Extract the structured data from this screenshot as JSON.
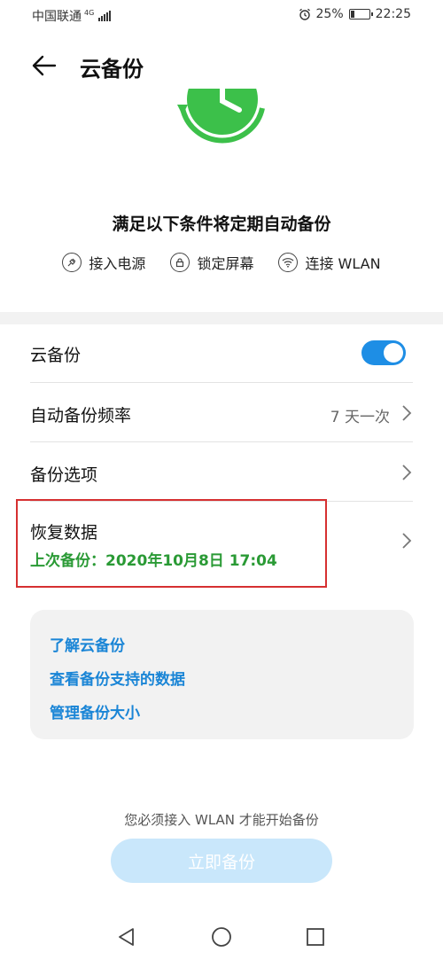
{
  "status_bar": {
    "carrier": "中国联通",
    "network_type": "4G",
    "battery_percent": "25%",
    "battery_level": 0.25,
    "time": "22:25"
  },
  "header": {
    "title": "云备份"
  },
  "conditions": {
    "title": "满足以下条件将定期自动备份",
    "items": [
      {
        "label": "接入电源",
        "icon": "plug-icon"
      },
      {
        "label": "锁定屏幕",
        "icon": "lock-icon"
      },
      {
        "label": "连接 WLAN",
        "icon": "wifi-icon"
      }
    ]
  },
  "settings": {
    "cloud_backup": {
      "label": "云备份",
      "enabled": true
    },
    "auto_frequency": {
      "label": "自动备份频率",
      "value": "7 天一次"
    },
    "backup_options": {
      "label": "备份选项"
    },
    "restore_data": {
      "label": "恢复数据",
      "last_backup": "上次备份：2020年10月8日 17:04"
    }
  },
  "info_links": {
    "learn": "了解云备份",
    "supported_data": "查看备份支持的数据",
    "manage_size": "管理备份大小"
  },
  "footer": {
    "notice": "您必须接入 WLAN 才能开始备份",
    "backup_now": "立即备份"
  },
  "colors": {
    "accent": "#1e8ee5",
    "hero_green": "#3cc04a",
    "link_blue": "#1a85d6",
    "success_green": "#2a9a35",
    "highlight_red": "#d63031"
  }
}
